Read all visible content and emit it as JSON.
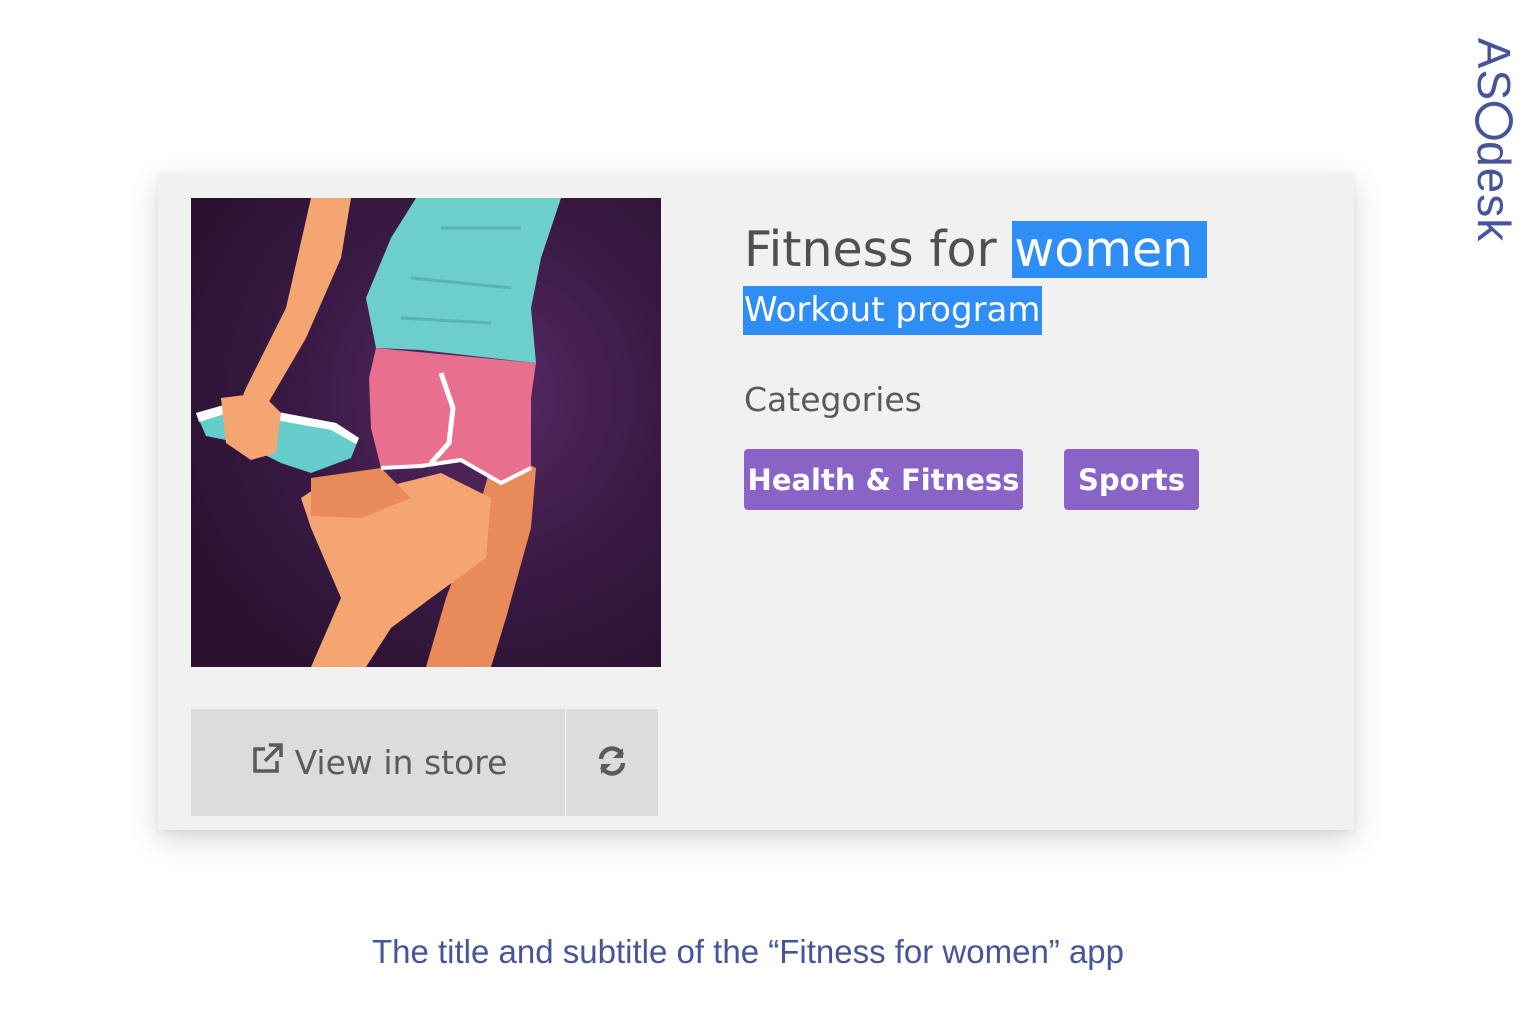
{
  "app": {
    "title_prefix": "Fitness for ",
    "title_highlight": "women",
    "subtitle": "Workout program",
    "categories_label": "Categories",
    "categories": [
      "Health & Fitness",
      "Sports"
    ],
    "view_in_store_label": "View in store"
  },
  "brand": {
    "logo_prefix": "AS",
    "logo_suffix": "desk"
  },
  "caption": "The title and subtitle of the “Fitness for women” app",
  "colors": {
    "highlight": "#2f8ef6",
    "category_tag": "#8a63c6",
    "brand": "#46549a",
    "card_bg": "#f1f1f1",
    "button_bg": "#dcdcdc"
  },
  "icons": {
    "store_button": "external-link-icon",
    "refresh_button": "refresh-icon"
  }
}
